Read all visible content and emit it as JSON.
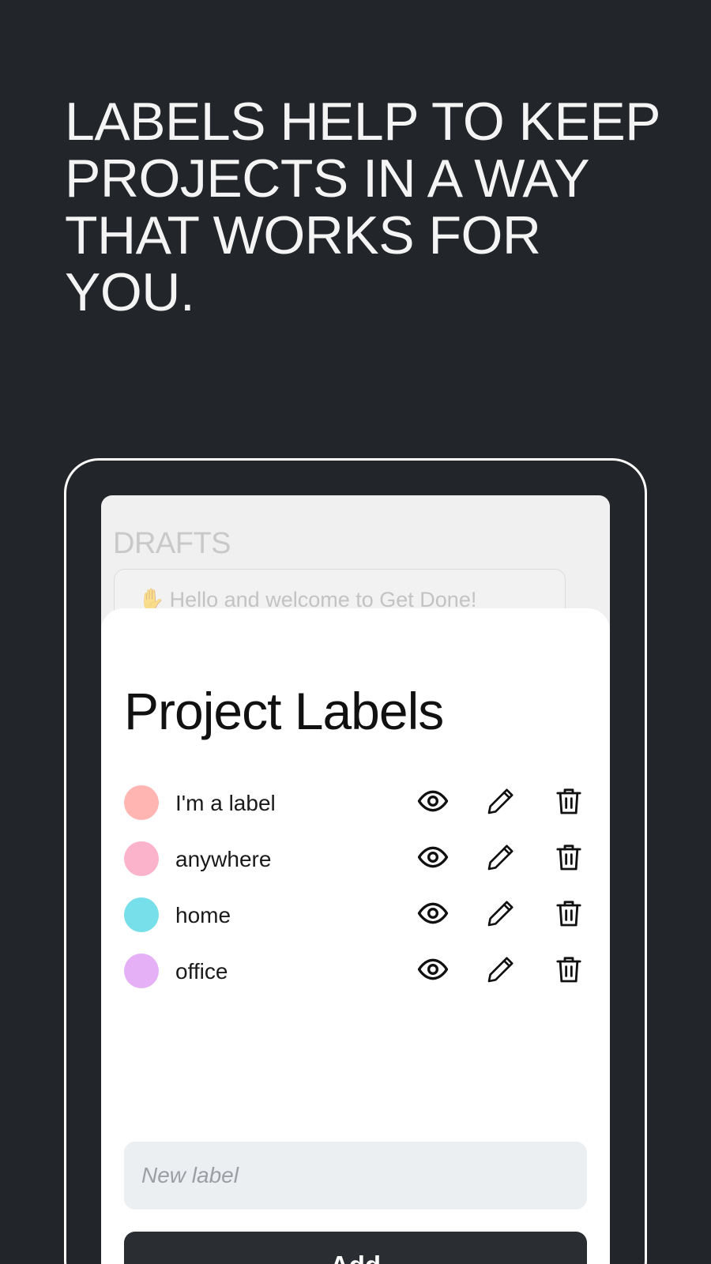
{
  "headline": "LABELS HELP TO KEEP PROJECTS IN A WAY THAT WORKS FOR YOU.",
  "background_screen": {
    "section_title": "DRAFTS",
    "card_text": "Hello and welcome to Get Done!"
  },
  "sheet": {
    "title": "Project Labels",
    "labels": [
      {
        "name": "I'm a label",
        "color": "#ffb6b3"
      },
      {
        "name": "anywhere",
        "color": "#fbb3cc"
      },
      {
        "name": "home",
        "color": "#77dfe9"
      },
      {
        "name": "office",
        "color": "#e6b0f7"
      }
    ],
    "row_actions": [
      "eye-icon",
      "pencil-icon",
      "trash-icon"
    ],
    "new_label_placeholder": "New label",
    "new_label_value": "",
    "add_button_label": "Add"
  }
}
